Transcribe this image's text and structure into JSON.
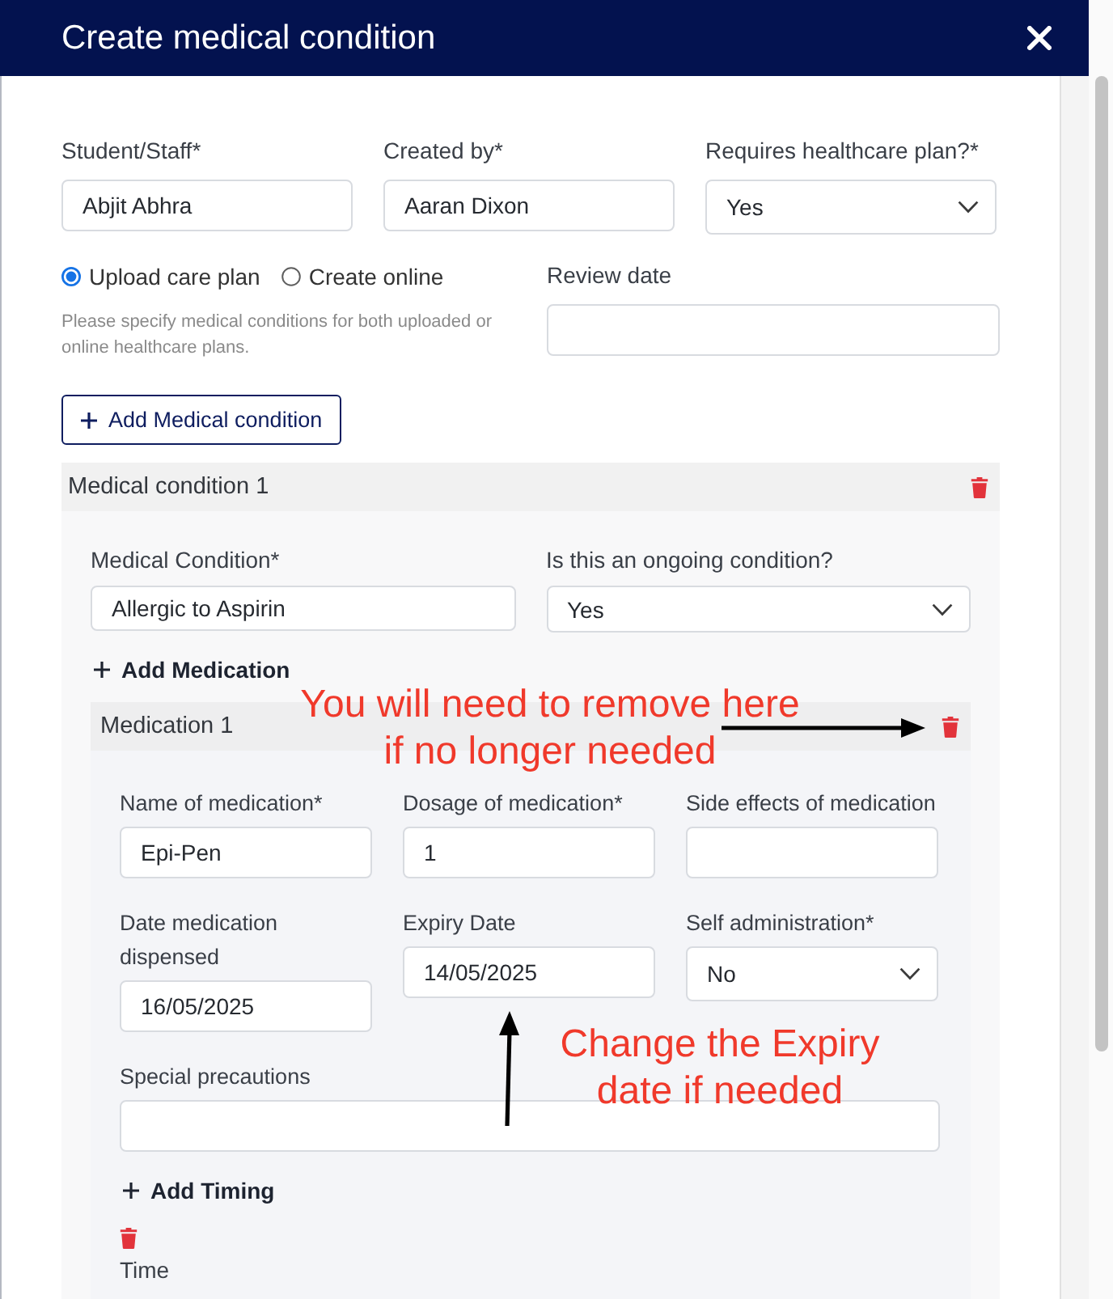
{
  "window": {
    "title": "Create medical condition"
  },
  "fields": [
    {
      "label": "Student/Staff*",
      "kind": "text",
      "value": "Abjit Abhra"
    },
    {
      "label": "Created by*",
      "kind": "text",
      "value": "Aaran Dixon"
    },
    {
      "label": "Requires healthcare plan?*",
      "kind": "select",
      "value": "Yes"
    }
  ],
  "care_plan": {
    "options": [
      {
        "label": "Upload care plan",
        "selected": true
      },
      {
        "label": "Create online",
        "selected": false
      }
    ],
    "help": "Please specify medical conditions for both uploaded or online healthcare plans."
  },
  "review_date": {
    "label": "Review date",
    "kind": "text"
  },
  "add_condition_button": "Add Medical condition",
  "conditions": [
    {
      "title": "Medical condition 1",
      "fields": [
        {
          "label": "Medical Condition*",
          "kind": "text",
          "value": "Allergic to Aspirin"
        },
        {
          "label": "Is this an ongoing condition?",
          "kind": "select",
          "value": "Yes"
        }
      ],
      "add_medication": "Add Medication",
      "medications": [
        {
          "title": "Medication 1",
          "fields": [
            {
              "label": "Name of medication*",
              "kind": "text",
              "value": "Epi-Pen"
            },
            {
              "label": "Dosage of medication*",
              "kind": "text",
              "value": "1"
            },
            {
              "label": "Side effects of medication",
              "kind": "text"
            },
            {
              "label": "Date medication dispensed",
              "kind": "text",
              "value": "16/05/2025"
            },
            {
              "label": "Expiry Date",
              "kind": "text",
              "value": "14/05/2025"
            },
            {
              "label": "Self administration*",
              "kind": "select",
              "value": "No"
            }
          ],
          "special_precautions": {
            "label": "Special precautions",
            "kind": "text"
          },
          "add_timing": "Add Timing",
          "timings": [
            {
              "label": "Time"
            }
          ]
        }
      ]
    }
  ],
  "annotations": [
    {
      "text": "You will need to remove here if no longer needed"
    },
    {
      "text": "Change the Expiry date if needed"
    }
  ]
}
